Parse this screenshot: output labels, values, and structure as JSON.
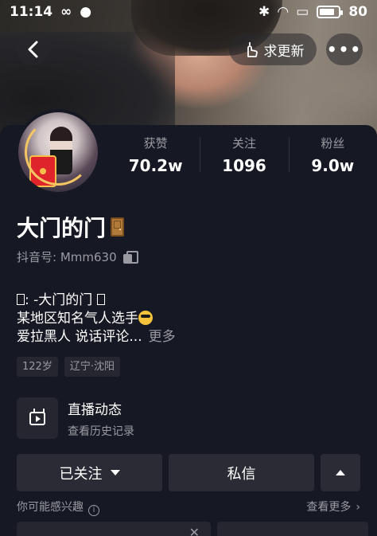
{
  "status_bar": {
    "time": "11:14",
    "battery": "80",
    "battery_level": 0.8
  },
  "header": {
    "update_label": "求更新",
    "more_label": "•••"
  },
  "profile": {
    "stats": [
      {
        "label": "获赞",
        "value": "70.2w"
      },
      {
        "label": "关注",
        "value": "1096"
      },
      {
        "label": "粉丝",
        "value": "9.0w"
      }
    ],
    "name": "大门的门",
    "douyin_id": "抖音号: Mmm630",
    "bio": {
      "line1": ": -大门的门",
      "line2": "某地区知名气人选手",
      "line3": "爱拉黑人 说话评论...",
      "more": "更多"
    },
    "tags": [
      "122岁",
      "辽宁·沈阳"
    ]
  },
  "live": {
    "title": "直播动态",
    "subtitle": "查看历史记录"
  },
  "actions": {
    "followed_label": "已关注",
    "message_label": "私信"
  },
  "suggestions": {
    "title": "你可能感兴趣",
    "see_more": "查看更多"
  },
  "icons": {
    "back": "back-arrow-icon",
    "update": "hand-pointing-icon",
    "more": "more-dots-icon",
    "copy": "copy-icon",
    "tv": "live-tv-icon",
    "info": "info-icon",
    "close": "close-icon"
  }
}
